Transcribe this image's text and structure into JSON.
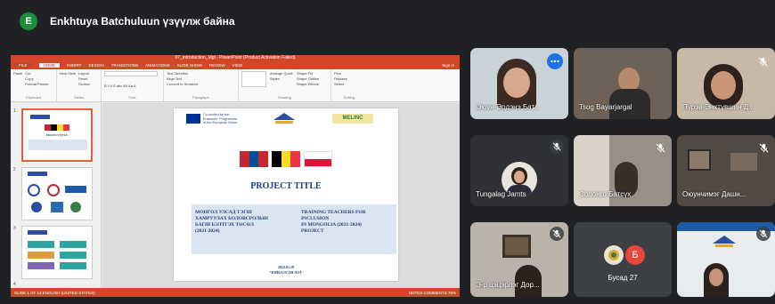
{
  "presenter": {
    "initial": "E",
    "label": "Enkhtuya Batchuluun үзүүлж байна"
  },
  "ppt": {
    "window_title": "07_introduction_Mgl - PowerPoint (Product Activation Failed)",
    "menu": [
      "FILE",
      "HOME",
      "INSERT",
      "DESIGN",
      "TRANSITIONS",
      "ANIMATIONS",
      "SLIDE SHOW",
      "REVIEW",
      "VIEW"
    ],
    "sign_in": "Sign in",
    "ribbon_groups": [
      {
        "label": "Clipboard",
        "rows": [
          "Cut",
          "Copy",
          "Format Painter"
        ],
        "big": "Paste"
      },
      {
        "label": "Slides",
        "rows": [
          "Layout",
          "Reset",
          "Section"
        ],
        "big": "New Slide"
      },
      {
        "label": "Font",
        "rows": [
          "B I U S abc AV Aa A"
        ]
      },
      {
        "label": "Paragraph",
        "rows": [
          "Text Direction",
          "Align Text",
          "Convert to SmartArt"
        ]
      },
      {
        "label": "Drawing",
        "rows": [
          "Shape Fill",
          "Shape Outline",
          "Shape Effects"
        ],
        "big": "Arrange  Quick Styles"
      },
      {
        "label": "Editing",
        "rows": [
          "Find",
          "Replace",
          "Select"
        ]
      }
    ],
    "thumb_numbers": [
      "1",
      "2",
      "3",
      "4"
    ],
    "status_left": "SLIDE 1 OF 13   ENGLISH (UNITED STATES)",
    "status_right": "NOTES   COMMENTS   76%",
    "slide": {
      "eu_text": [
        "Co-funded by the",
        "Erasmus+ Programme",
        "of the European Union"
      ],
      "melinc": "MELINC",
      "project_title": "PROJECT TITLE",
      "left_block": [
        "МОНГОЛ УЛСАД ТЭГШ",
        "ХАМРУУЛАХ БОЛОВСРОЛЫН",
        "БАГШ БЭЛТГЭХ ТӨСӨЛ",
        "(2021-2024)"
      ],
      "right_block": [
        "TRAINING TEACHERS FOR",
        "INCLUSION",
        "IN MONGOLIA (2021-2024)",
        "PROJECT"
      ],
      "date_lines": [
        "2022.01.18",
        "ЧОЙБАЛСАН ХОТ"
      ]
    },
    "thumb1_title": "PROJECT TITLE"
  },
  "participants": [
    {
      "name": "Оюун-Эрдэнэ Бат...",
      "muted": false,
      "more": true
    },
    {
      "name": "Tsog Bayarjargal",
      "muted": false
    },
    {
      "name": "Пүрэв-Энхтүвшин Д...",
      "muted": true
    },
    {
      "name": "",
      "muted": true
    },
    {
      "name": "Tungalag Jamts",
      "muted": true
    },
    {
      "name": "Солонго Батсүх",
      "muted": true
    },
    {
      "name": "Оюунчимэг Дашн...",
      "muted": true
    },
    {
      "name": "Э-р цэцэрлэг Дор...",
      "muted": true
    },
    {
      "name": "Бусад 27",
      "muted": false,
      "badge": "Б"
    },
    {
      "name": "",
      "muted": true
    }
  ],
  "colors": {
    "accent": "#d24726",
    "bg": "#202124",
    "tile": "#3c4043",
    "others_badge": "#e8453c"
  }
}
